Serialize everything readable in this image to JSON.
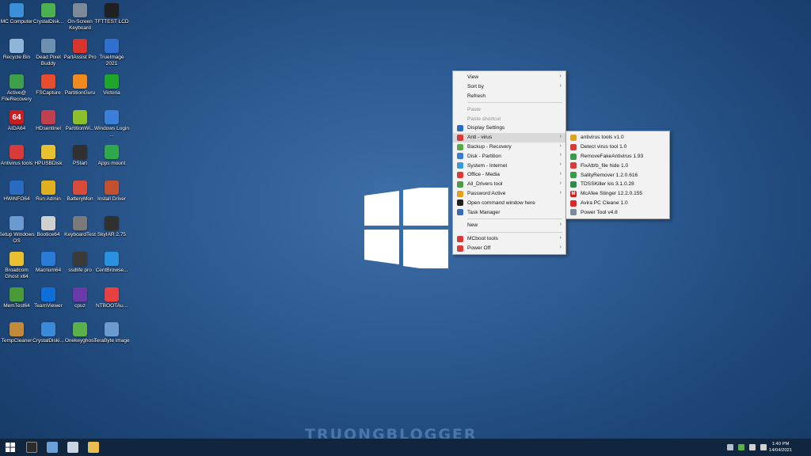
{
  "desktop_icons": [
    {
      "label": "MC Computer",
      "icon": "computer-icon",
      "color": "#3a8fd8"
    },
    {
      "label": "CrystalDisk...",
      "icon": "crystaldisk-icon",
      "color": "#4caf50"
    },
    {
      "label": "On-Screen Keyboard",
      "icon": "keyboard-icon",
      "color": "#7a8a99"
    },
    {
      "label": "TFTTEST LCD",
      "icon": "tfttest-icon",
      "color": "#202020"
    },
    {
      "label": "Recycle Bin",
      "icon": "recycle-bin-icon",
      "color": "#8fb6d8"
    },
    {
      "label": "Dead Pixel Buddy",
      "icon": "dead-pixel-icon",
      "color": "#6d8fb0"
    },
    {
      "label": "PartAssist Pro",
      "icon": "partassist-icon",
      "color": "#d8342c"
    },
    {
      "label": "TrueImage 2021",
      "icon": "trueimage-icon",
      "color": "#2f6fd0"
    },
    {
      "label": "Active@ FileRecovery",
      "icon": "file-recovery-icon",
      "color": "#3fa04a"
    },
    {
      "label": "FSCapture",
      "icon": "fscapture-icon",
      "color": "#e84c2c"
    },
    {
      "label": "PartitionGuru",
      "icon": "partitionguru-icon",
      "color": "#f08a1c"
    },
    {
      "label": "Victoria",
      "icon": "victoria-icon",
      "color": "#1fa52a"
    },
    {
      "label": "AIDA64",
      "icon": "aida64-icon",
      "color": "#c81e1e",
      "glyph": "64"
    },
    {
      "label": "HDsentinel",
      "icon": "hdsentinel-icon",
      "color": "#c04050"
    },
    {
      "label": "PartitionWi...",
      "icon": "partitionwizard-icon",
      "color": "#8cbf2a"
    },
    {
      "label": "Windows Login ...",
      "icon": "windows-login-icon",
      "color": "#3c7fd8"
    },
    {
      "label": "Antivirus tools",
      "icon": "antivirus-icon",
      "color": "#d83a3a"
    },
    {
      "label": "HPUSBDisk",
      "icon": "hpusbdisk-icon",
      "color": "#e8c030"
    },
    {
      "label": "PStart",
      "icon": "pstart-icon",
      "color": "#303030"
    },
    {
      "label": "Apps mount",
      "icon": "apps-mount-icon",
      "color": "#2ea84a"
    },
    {
      "label": "HWiNFO64",
      "icon": "hwinfo-icon",
      "color": "#2a6abf"
    },
    {
      "label": "Run Admin",
      "icon": "run-admin-icon",
      "color": "#e0b020"
    },
    {
      "label": "BatteryMon",
      "icon": "batterymon-icon",
      "color": "#d84a3a"
    },
    {
      "label": "Install Driver",
      "icon": "install-driver-icon",
      "color": "#c05030"
    },
    {
      "label": "Setup Windows OS",
      "icon": "setup-windows-icon",
      "color": "#6a9ad0"
    },
    {
      "label": "Bootice64",
      "icon": "bootice-icon",
      "color": "#d0d0d0"
    },
    {
      "label": "KeyboardTest",
      "icon": "keyboardtest-icon",
      "color": "#7a7a7a"
    },
    {
      "label": "SkyIAR 2.75",
      "icon": "skyiar-icon",
      "color": "#303030"
    },
    {
      "label": "Broadcom Ghost x64",
      "icon": "ghost-icon",
      "color": "#e8c030"
    },
    {
      "label": "Macrium64",
      "icon": "macrium-icon",
      "color": "#2a7ad8"
    },
    {
      "label": "ssdlife pro",
      "icon": "ssdlife-icon",
      "color": "#3a3a3a"
    },
    {
      "label": "CentBrowse...",
      "icon": "centbrowser-icon",
      "color": "#2a90e0"
    },
    {
      "label": "MemTest64",
      "icon": "memtest-icon",
      "color": "#4a9a3a"
    },
    {
      "label": "TeamViewer",
      "icon": "teamviewer-icon",
      "color": "#0e6fd8"
    },
    {
      "label": "cpuz",
      "icon": "cpuz-icon",
      "color": "#6a3aa8"
    },
    {
      "label": "NTBOOTAu...",
      "icon": "ntbootautofix-icon",
      "color": "#e84040"
    },
    {
      "label": "TempCleaner",
      "icon": "tempcleaner-icon",
      "color": "#c08a3a"
    },
    {
      "label": "CrystalDiski...",
      "icon": "crystaldiskinfo-icon",
      "color": "#3a8ad8"
    },
    {
      "label": "Onekeyghost",
      "icon": "onekeyghost-icon",
      "color": "#5ab04a"
    },
    {
      "label": "TeraByte image",
      "icon": "terabyte-icon",
      "color": "#6a9ad0"
    }
  ],
  "context_menu": {
    "items": [
      {
        "label": "View",
        "arrow": true,
        "icon": ""
      },
      {
        "label": "Sort by",
        "arrow": true,
        "icon": ""
      },
      {
        "label": "Refresh",
        "arrow": false,
        "icon": ""
      },
      {
        "sep": true
      },
      {
        "label": "Paste",
        "disabled": true,
        "icon": ""
      },
      {
        "label": "Paste shortcut",
        "disabled": true,
        "icon": ""
      },
      {
        "label": "Display Settings",
        "icon": "display-settings-icon",
        "color": "#2a6abf"
      },
      {
        "label": "Anti - virus",
        "arrow": true,
        "active": true,
        "icon": "antivirus-menu-icon",
        "color": "#d83a3a"
      },
      {
        "label": "Backup - Recovery",
        "arrow": true,
        "icon": "backup-icon",
        "color": "#5aa84a"
      },
      {
        "label": "Disk - Partition",
        "arrow": true,
        "icon": "disk-icon",
        "color": "#3a7ad8"
      },
      {
        "label": "System - Internet",
        "arrow": true,
        "icon": "system-internet-icon",
        "color": "#3a9ad8"
      },
      {
        "label": "Office - Media",
        "arrow": true,
        "icon": "office-icon",
        "color": "#d83a3a"
      },
      {
        "label": "All_Drivers tool",
        "arrow": true,
        "icon": "drivers-icon",
        "color": "#4a9a4a"
      },
      {
        "label": "Password Active",
        "arrow": true,
        "icon": "password-icon",
        "color": "#e0a020"
      },
      {
        "label": "Open command window here",
        "icon": "cmd-icon",
        "color": "#202020"
      },
      {
        "label": "Task Manager",
        "icon": "task-manager-icon",
        "color": "#3a6ab0"
      },
      {
        "sep": true
      },
      {
        "label": "New",
        "arrow": true,
        "icon": ""
      },
      {
        "sep": true
      },
      {
        "label": "MCboot tools",
        "arrow": true,
        "icon": "mcboot-icon",
        "color": "#d83a3a"
      },
      {
        "label": "Power Off",
        "arrow": true,
        "icon": "power-icon",
        "color": "#d83a3a"
      }
    ]
  },
  "submenu": {
    "items": [
      {
        "label": "antivirus tools v1.0",
        "icon": "antivirus-tools-icon",
        "color": "#e0a020"
      },
      {
        "label": "Detect virus tool 1.0",
        "icon": "detect-virus-icon",
        "color": "#d83a3a"
      },
      {
        "label": "RemoveFakeAntivirus 1.93",
        "icon": "remove-fake-av-icon",
        "color": "#3a9a4a"
      },
      {
        "label": "FixAttrb_file hide 1.0",
        "icon": "fixattrb-icon",
        "color": "#d83a3a"
      },
      {
        "label": "SalityRemover 1.2.0.616",
        "icon": "sality-icon",
        "color": "#3a9a4a"
      },
      {
        "label": "TDSSKiller kis 3.1.0.28",
        "icon": "tdsskiller-icon",
        "color": "#2a8a4a"
      },
      {
        "label": "McAfee Stinger 12.2.0.155",
        "icon": "mcafee-icon",
        "color": "#c81e1e",
        "glyph": "M"
      },
      {
        "label": "Avira PC Cleane 1.0",
        "icon": "avira-icon",
        "color": "#d8282a"
      },
      {
        "label": "Power Tool v4.8",
        "icon": "power-tool-icon",
        "color": "#7a8a99"
      }
    ]
  },
  "watermark": "TRUONGBLOGGER",
  "clock": {
    "time": "1:40 PM",
    "date": "14/04/2021"
  },
  "colors": {
    "taskbar": "#10263f",
    "menu_bg": "#f2f2f2",
    "menu_active": "#d9d9d9"
  }
}
